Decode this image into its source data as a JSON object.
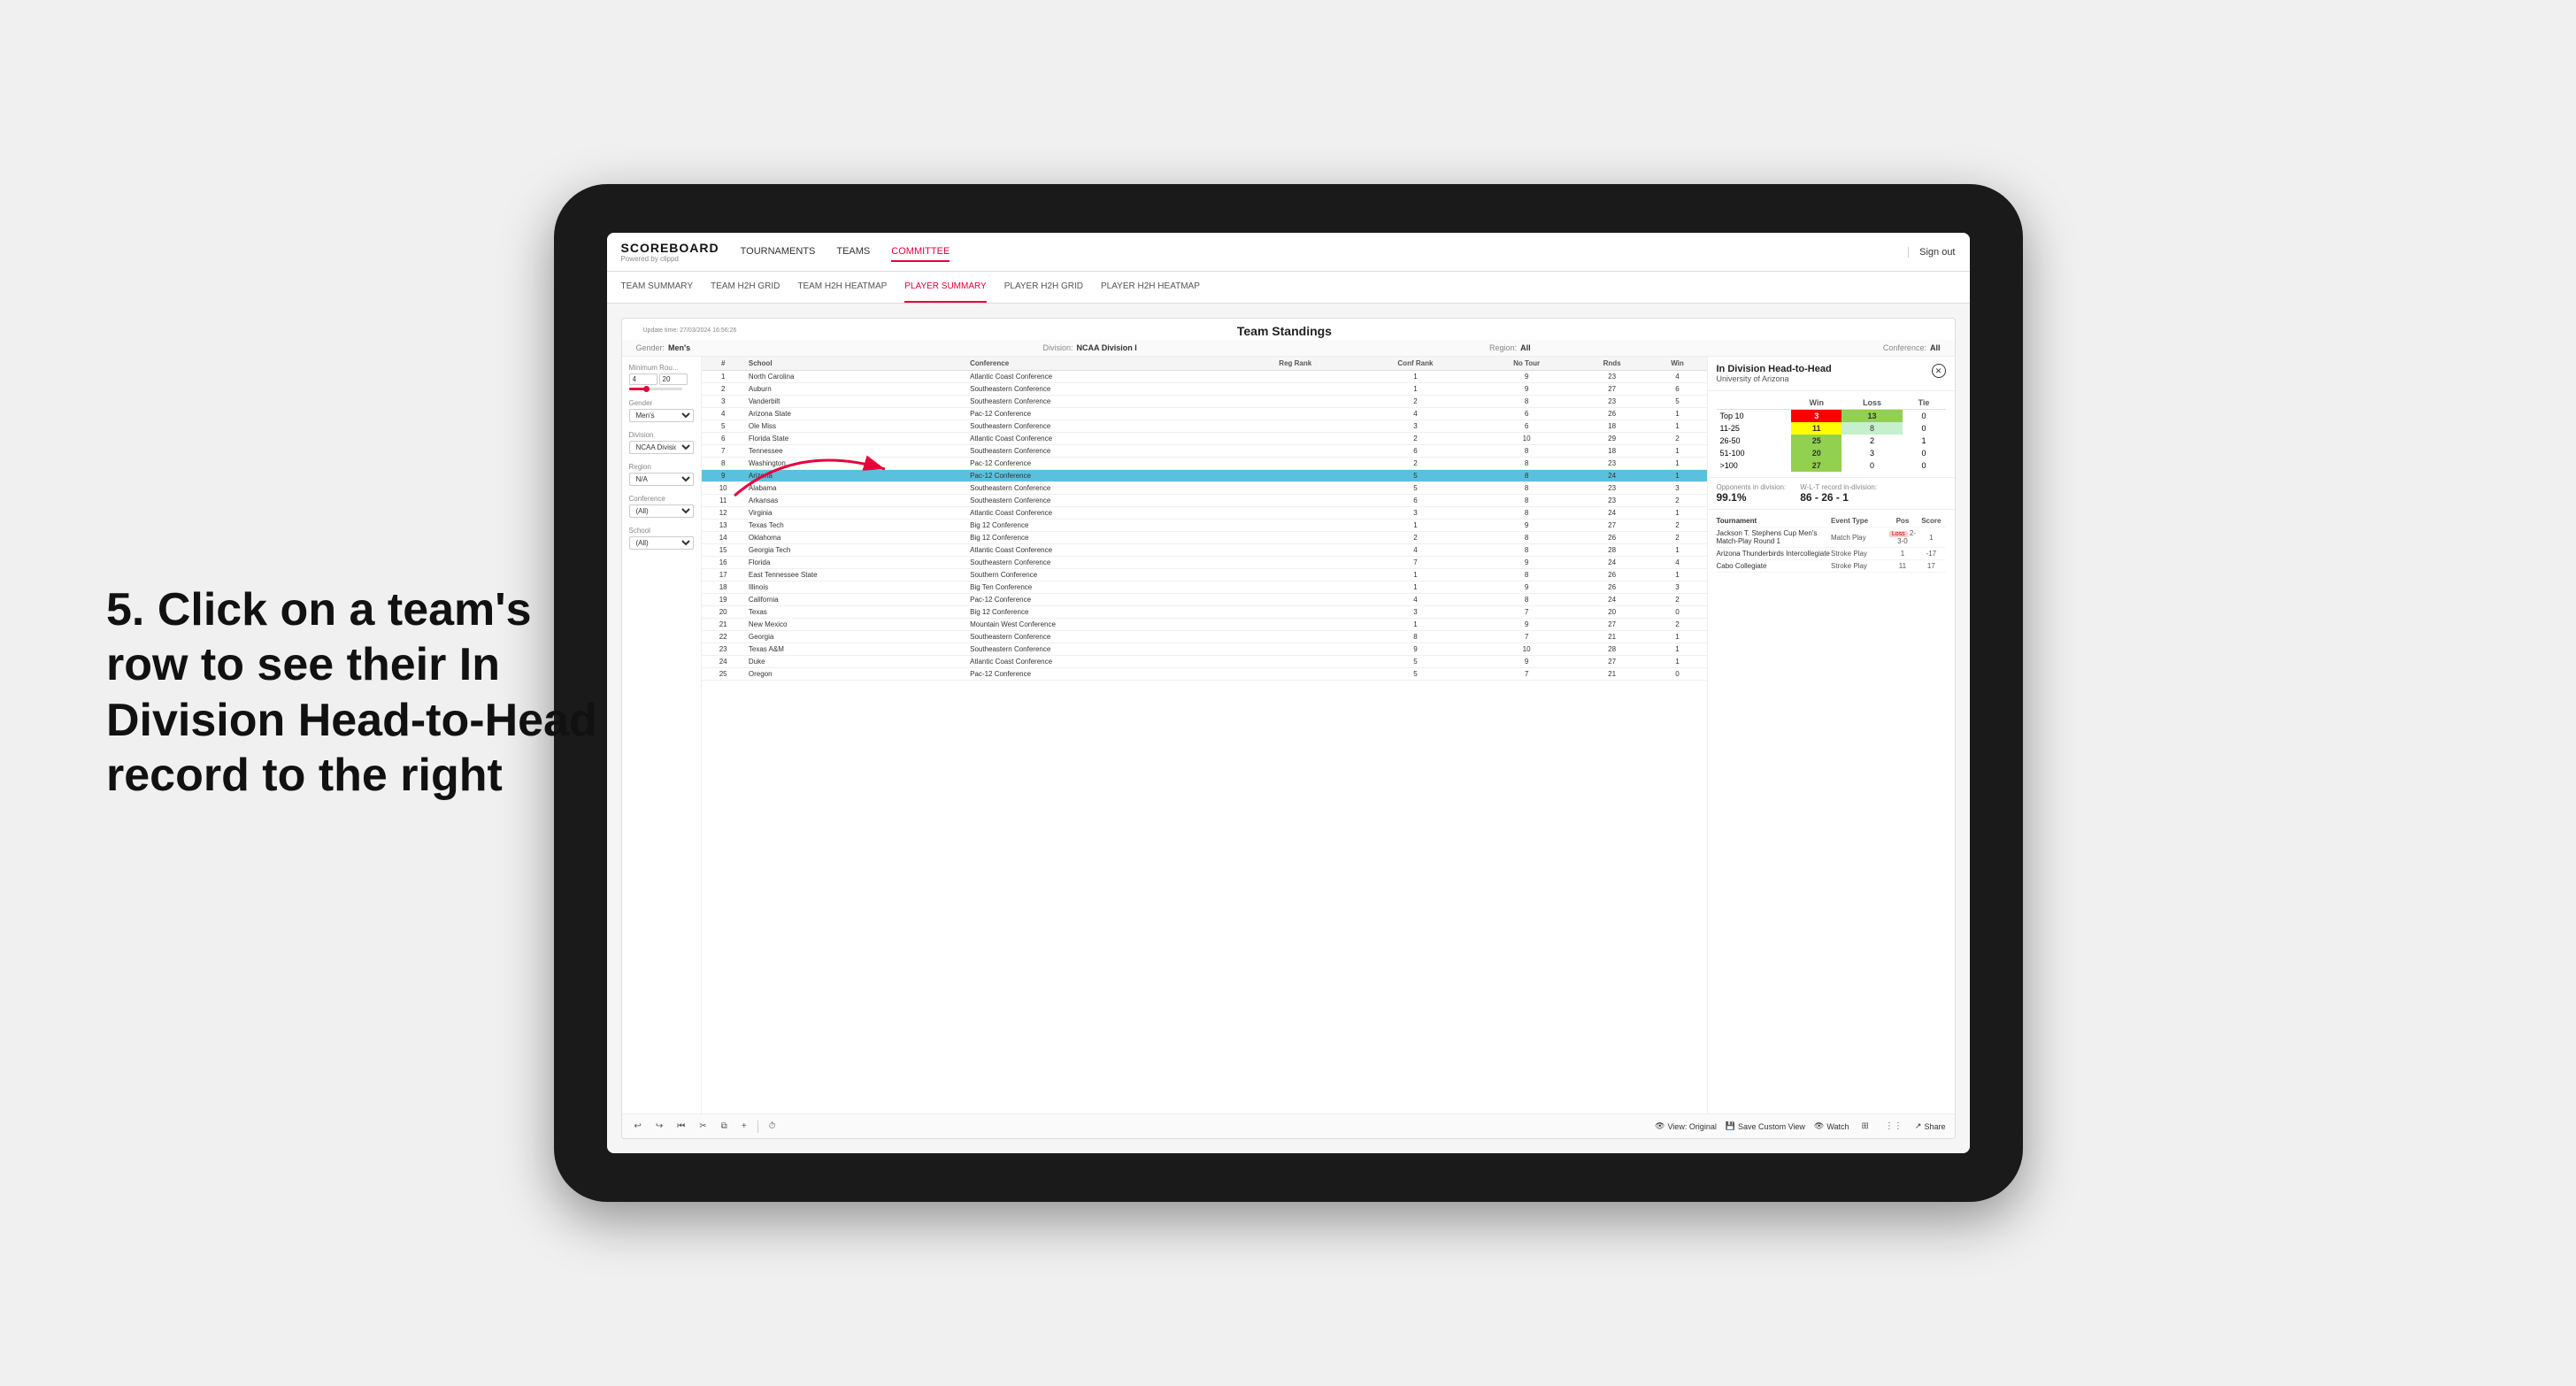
{
  "instruction": {
    "text": "5. Click on a team's row to see their In Division Head-to-Head record to the right"
  },
  "nav": {
    "logo": "SCOREBOARD",
    "logo_sub": "Powered by clippd",
    "items": [
      "TOURNAMENTS",
      "TEAMS",
      "COMMITTEE"
    ],
    "active_item": "COMMITTEE",
    "sign_out": "Sign out"
  },
  "sub_nav": {
    "items": [
      "TEAM SUMMARY",
      "TEAM H2H GRID",
      "TEAM H2H HEATMAP",
      "PLAYER SUMMARY",
      "PLAYER H2H GRID",
      "PLAYER H2H HEATMAP"
    ],
    "active_item": "PLAYER SUMMARY"
  },
  "panel": {
    "title": "Team Standings",
    "update_time": "Update time: 27/03/2024 16:56:26",
    "meta": {
      "gender_label": "Gender:",
      "gender_value": "Men's",
      "division_label": "Division:",
      "division_value": "NCAA Division I",
      "region_label": "Region:",
      "region_value": "All",
      "conference_label": "Conference:",
      "conference_value": "All"
    },
    "filters": {
      "minimum_rounds_label": "Minimum Rou...",
      "min_val": "4",
      "max_val": "20",
      "gender_label": "Gender",
      "gender_value": "Men's",
      "division_label": "Division",
      "division_value": "NCAA Division I",
      "region_label": "Region",
      "region_value": "N/A",
      "conference_label": "Conference",
      "conference_value": "(All)",
      "school_label": "School",
      "school_value": "(All)"
    },
    "table": {
      "headers": [
        "#",
        "School",
        "Conference",
        "Reg Rank",
        "Conf Rank",
        "No Tour",
        "Rnds",
        "Win"
      ],
      "rows": [
        {
          "num": 1,
          "school": "North Carolina",
          "conference": "Atlantic Coast Conference",
          "reg_rank": "",
          "conf_rank": 1,
          "no_tour": 9,
          "rnds": 23,
          "win": 4,
          "highlighted": false
        },
        {
          "num": 2,
          "school": "Auburn",
          "conference": "Southeastern Conference",
          "reg_rank": "",
          "conf_rank": 1,
          "no_tour": 9,
          "rnds": 27,
          "win": 6,
          "highlighted": false
        },
        {
          "num": 3,
          "school": "Vanderbilt",
          "conference": "Southeastern Conference",
          "reg_rank": "",
          "conf_rank": 2,
          "no_tour": 8,
          "rnds": 23,
          "win": 5,
          "highlighted": false
        },
        {
          "num": 4,
          "school": "Arizona State",
          "conference": "Pac-12 Conference",
          "reg_rank": "",
          "conf_rank": 4,
          "no_tour": 6,
          "rnds": 26,
          "win": 1,
          "highlighted": false
        },
        {
          "num": 5,
          "school": "Ole Miss",
          "conference": "Southeastern Conference",
          "reg_rank": "",
          "conf_rank": 3,
          "no_tour": 6,
          "rnds": 18,
          "win": 1,
          "highlighted": false
        },
        {
          "num": 6,
          "school": "Florida State",
          "conference": "Atlantic Coast Conference",
          "reg_rank": "",
          "conf_rank": 2,
          "no_tour": 10,
          "rnds": 29,
          "win": 2,
          "highlighted": false
        },
        {
          "num": 7,
          "school": "Tennessee",
          "conference": "Southeastern Conference",
          "reg_rank": "",
          "conf_rank": 6,
          "no_tour": 8,
          "rnds": 18,
          "win": 1,
          "highlighted": false
        },
        {
          "num": 8,
          "school": "Washington",
          "conference": "Pac-12 Conference",
          "reg_rank": "",
          "conf_rank": 2,
          "no_tour": 8,
          "rnds": 23,
          "win": 1,
          "highlighted": false
        },
        {
          "num": 9,
          "school": "Arizona",
          "conference": "Pac-12 Conference",
          "reg_rank": "",
          "conf_rank": 5,
          "no_tour": 8,
          "rnds": 24,
          "win": 1,
          "highlighted": true
        },
        {
          "num": 10,
          "school": "Alabama",
          "conference": "Southeastern Conference",
          "reg_rank": "",
          "conf_rank": 5,
          "no_tour": 8,
          "rnds": 23,
          "win": 3,
          "highlighted": false
        },
        {
          "num": 11,
          "school": "Arkansas",
          "conference": "Southeastern Conference",
          "reg_rank": "",
          "conf_rank": 6,
          "no_tour": 8,
          "rnds": 23,
          "win": 2,
          "highlighted": false
        },
        {
          "num": 12,
          "school": "Virginia",
          "conference": "Atlantic Coast Conference",
          "reg_rank": "",
          "conf_rank": 3,
          "no_tour": 8,
          "rnds": 24,
          "win": 1,
          "highlighted": false
        },
        {
          "num": 13,
          "school": "Texas Tech",
          "conference": "Big 12 Conference",
          "reg_rank": "",
          "conf_rank": 1,
          "no_tour": 9,
          "rnds": 27,
          "win": 2,
          "highlighted": false
        },
        {
          "num": 14,
          "school": "Oklahoma",
          "conference": "Big 12 Conference",
          "reg_rank": "",
          "conf_rank": 2,
          "no_tour": 8,
          "rnds": 26,
          "win": 2,
          "highlighted": false
        },
        {
          "num": 15,
          "school": "Georgia Tech",
          "conference": "Atlantic Coast Conference",
          "reg_rank": "",
          "conf_rank": 4,
          "no_tour": 8,
          "rnds": 28,
          "win": 1,
          "highlighted": false
        },
        {
          "num": 16,
          "school": "Florida",
          "conference": "Southeastern Conference",
          "reg_rank": "",
          "conf_rank": 7,
          "no_tour": 9,
          "rnds": 24,
          "win": 4,
          "highlighted": false
        },
        {
          "num": 17,
          "school": "East Tennessee State",
          "conference": "Southern Conference",
          "reg_rank": "",
          "conf_rank": 1,
          "no_tour": 8,
          "rnds": 26,
          "win": 1,
          "highlighted": false
        },
        {
          "num": 18,
          "school": "Illinois",
          "conference": "Big Ten Conference",
          "reg_rank": "",
          "conf_rank": 1,
          "no_tour": 9,
          "rnds": 26,
          "win": 3,
          "highlighted": false
        },
        {
          "num": 19,
          "school": "California",
          "conference": "Pac-12 Conference",
          "reg_rank": "",
          "conf_rank": 4,
          "no_tour": 8,
          "rnds": 24,
          "win": 2,
          "highlighted": false
        },
        {
          "num": 20,
          "school": "Texas",
          "conference": "Big 12 Conference",
          "reg_rank": "",
          "conf_rank": 3,
          "no_tour": 7,
          "rnds": 20,
          "win": 0,
          "highlighted": false
        },
        {
          "num": 21,
          "school": "New Mexico",
          "conference": "Mountain West Conference",
          "reg_rank": "",
          "conf_rank": 1,
          "no_tour": 9,
          "rnds": 27,
          "win": 2,
          "highlighted": false
        },
        {
          "num": 22,
          "school": "Georgia",
          "conference": "Southeastern Conference",
          "reg_rank": "",
          "conf_rank": 8,
          "no_tour": 7,
          "rnds": 21,
          "win": 1,
          "highlighted": false
        },
        {
          "num": 23,
          "school": "Texas A&M",
          "conference": "Southeastern Conference",
          "reg_rank": "",
          "conf_rank": 9,
          "no_tour": 10,
          "rnds": 28,
          "win": 1,
          "highlighted": false
        },
        {
          "num": 24,
          "school": "Duke",
          "conference": "Atlantic Coast Conference",
          "reg_rank": "",
          "conf_rank": 5,
          "no_tour": 9,
          "rnds": 27,
          "win": 1,
          "highlighted": false
        },
        {
          "num": 25,
          "school": "Oregon",
          "conference": "Pac-12 Conference",
          "reg_rank": "",
          "conf_rank": 5,
          "no_tour": 7,
          "rnds": 21,
          "win": 0,
          "highlighted": false
        }
      ]
    }
  },
  "right_panel": {
    "title": "In Division Head-to-Head",
    "team": "University of Arizona",
    "table": {
      "headers": [
        "",
        "Win",
        "Loss",
        "Tie"
      ],
      "rows": [
        {
          "label": "Top 10",
          "win": 3,
          "loss": 13,
          "tie": 0,
          "win_class": "cell-red",
          "loss_class": "cell-green"
        },
        {
          "label": "11-25",
          "win": 11,
          "loss": 8,
          "tie": 0,
          "win_class": "cell-yellow",
          "loss_class": "cell-light-green"
        },
        {
          "label": "26-50",
          "win": 25,
          "loss": 2,
          "tie": 1,
          "win_class": "cell-green",
          "loss_class": ""
        },
        {
          "label": "51-100",
          "win": 20,
          "loss": 3,
          "tie": 0,
          "win_class": "cell-green",
          "loss_class": ""
        },
        {
          "label": ">100",
          "win": 27,
          "loss": 0,
          "tie": 0,
          "win_class": "cell-green",
          "loss_class": ""
        }
      ]
    },
    "opponents_pct_label": "Opponents in division:",
    "opponents_pct": "99.1%",
    "wlt_label": "W-L-T record in-division:",
    "wlt": "86 - 26 - 1",
    "tournament_label": "Tournament",
    "event_type_label": "Event Type",
    "pos_label": "Pos",
    "score_label": "Score",
    "tournaments": [
      {
        "name": "Jackson T. Stephens Cup Men's Match-Play Round 1",
        "type": "Match Play",
        "result": "Loss",
        "pos": "2-3-0",
        "score": "1"
      },
      {
        "name": "Arizona Thunderbirds Intercollegiate",
        "type": "Stroke Play",
        "result": "",
        "pos": "1",
        "score": "-17"
      },
      {
        "name": "Cabo Collegiate",
        "type": "Stroke Play",
        "result": "",
        "pos": "11",
        "score": "17"
      }
    ]
  },
  "toolbar": {
    "view_original": "View: Original",
    "save_custom": "Save Custom View",
    "watch": "Watch",
    "share": "Share"
  }
}
